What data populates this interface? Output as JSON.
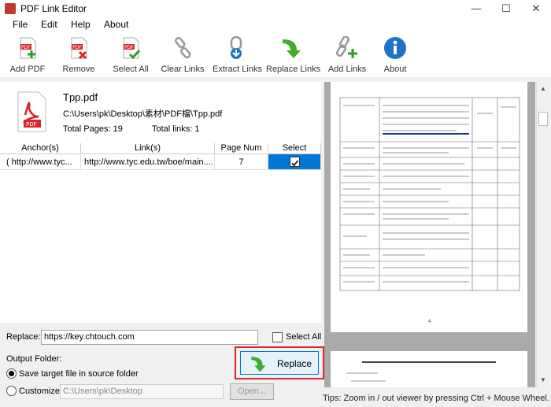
{
  "window": {
    "title": "PDF Link Editor",
    "minimize": "—",
    "maximize": "☐",
    "close": "✕"
  },
  "menu": [
    "File",
    "Edit",
    "Help",
    "About"
  ],
  "toolbar": {
    "add_pdf": "Add PDF",
    "remove": "Remove",
    "select_all": "Select All",
    "clear_links": "Clear Links",
    "extract_links": "Extract Links",
    "replace_links": "Replace Links",
    "add_links": "Add Links",
    "about": "About"
  },
  "file": {
    "name": "Tpp.pdf",
    "path": "C:\\Users\\pk\\Desktop\\素材\\PDF檔\\Tpp.pdf",
    "total_pages": "Total Pages: 19",
    "total_links": "Total links: 1"
  },
  "table": {
    "headers": [
      "Anchor(s)",
      "Link(s)",
      "Page Num",
      "Select"
    ],
    "row": {
      "anchor": "( http://www.tyc...",
      "link": "http://www.tyc.edu.tw/boe/main....",
      "page": "7"
    }
  },
  "replace": {
    "label": "Replace:",
    "value": "https://key.chtouch.com",
    "select_all": "Select All"
  },
  "output": {
    "label": "Output Folder:",
    "save_source": "Save target file in source folder",
    "customize": "Customize:",
    "custom_path": "C:\\Users\\pk\\Desktop",
    "open": "Open...",
    "replace_btn": "Replace"
  },
  "tips": "Tips: Zoom in / out viewer by pressing Ctrl + Mouse Wheel.",
  "viewer": {
    "page_no": "4"
  },
  "colors": {
    "accent": "#0078d7",
    "highlight": "#d9262c",
    "select_row": "#0078d7"
  }
}
